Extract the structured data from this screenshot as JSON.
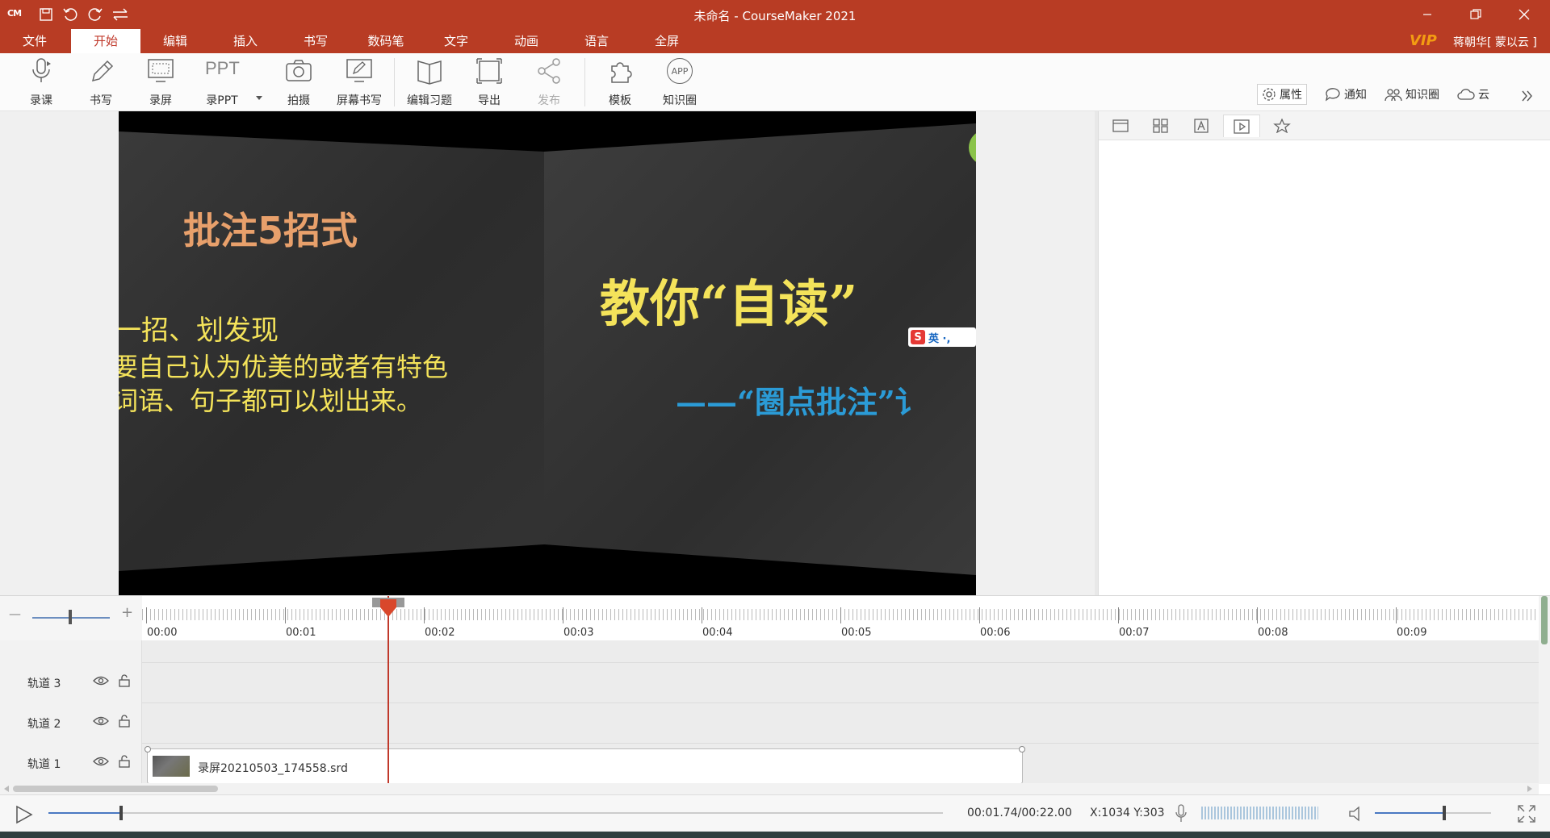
{
  "app": {
    "logo": "CM",
    "title": "未命名 - CourseMaker 2021",
    "accent": "#b83c24"
  },
  "menu": {
    "tabs": [
      {
        "label": "文件"
      },
      {
        "label": "开始"
      },
      {
        "label": "编辑"
      },
      {
        "label": "插入"
      },
      {
        "label": "书写"
      },
      {
        "label": "数码笔"
      },
      {
        "label": "文字"
      },
      {
        "label": "动画"
      },
      {
        "label": "语言"
      },
      {
        "label": "全屏"
      }
    ],
    "active_tab": "开始",
    "vip_label": "VIP",
    "user": "蒋朝华[ 蒙以云 ]"
  },
  "ribbon": {
    "buttons": [
      {
        "label": "录课",
        "icon": "microphone-icon"
      },
      {
        "label": "书写",
        "icon": "pencil-icon"
      },
      {
        "label": "录屏",
        "icon": "screen-record-icon"
      },
      {
        "label": "录PPT",
        "icon": "ppt-icon"
      },
      {
        "label": "拍摄",
        "icon": "camera-icon"
      },
      {
        "label": "屏幕书写",
        "icon": "screen-write-icon"
      },
      {
        "label": "编辑习题",
        "icon": "book-icon"
      },
      {
        "label": "导出",
        "icon": "export-icon"
      },
      {
        "label": "发布",
        "icon": "share-icon",
        "disabled": true
      },
      {
        "label": "模板",
        "icon": "puzzle-icon"
      },
      {
        "label": "知识圈",
        "icon": "app-icon"
      }
    ],
    "ppt_icon_text": "PPT",
    "app_icon_text": "APP",
    "right_tools": [
      {
        "label": "属性",
        "icon": "gear-icon",
        "active": true
      },
      {
        "label": "通知",
        "icon": "chat-icon"
      },
      {
        "label": "知识圈",
        "icon": "people-icon"
      },
      {
        "label": "云",
        "icon": "cloud-icon"
      }
    ]
  },
  "slide": {
    "left_title": "批注5招式",
    "left_line1": "一招、划发现",
    "left_line2": "要自己认为优美的或者有特色",
    "left_line3": "词语、句子都可以划出来。",
    "right_title": "教你“自读”",
    "right_subtitle": "——“圈点批注”讠",
    "ime_badge": "英 ·,"
  },
  "timeline": {
    "ticks": [
      "00:00",
      "00:01",
      "00:02",
      "00:03",
      "00:04",
      "00:05",
      "00:06",
      "00:07",
      "00:08",
      "00:09"
    ],
    "tracks": [
      {
        "name": "轨道 3"
      },
      {
        "name": "轨道 2"
      },
      {
        "name": "轨道 1"
      }
    ],
    "clip_name": "录屏20210503_174558.srd",
    "zoom_minus": "—",
    "zoom_plus": "+"
  },
  "playbar": {
    "time": "00:01.74/00:22.00",
    "coord": "X:1034 Y:303",
    "progress": 0.081,
    "volume": 0.6
  }
}
